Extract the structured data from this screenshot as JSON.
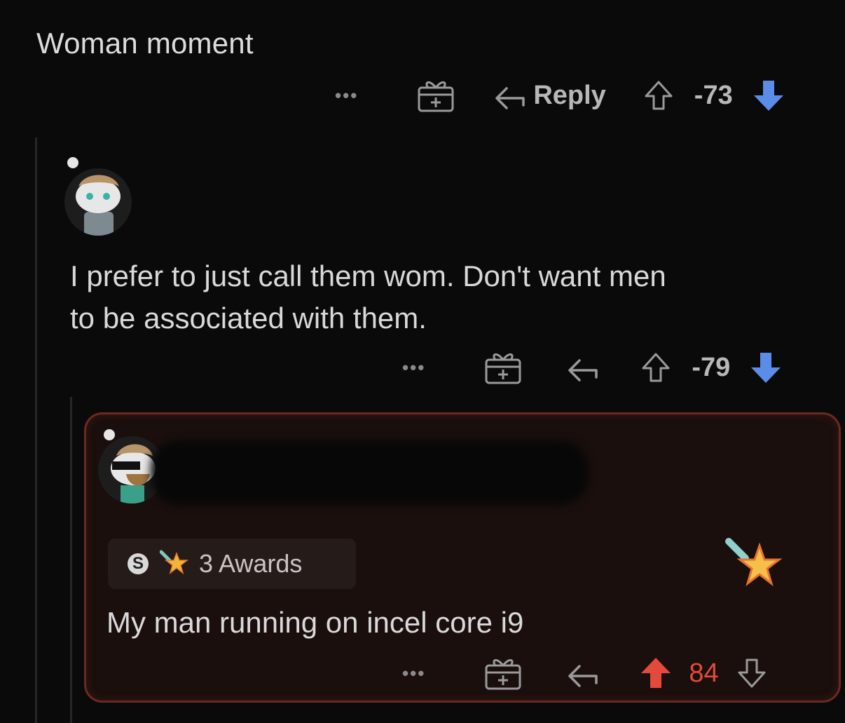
{
  "post": {
    "title": "Woman moment"
  },
  "comment1": {
    "actions": {
      "more": "•••",
      "reply_label": "Reply",
      "score": "-73"
    }
  },
  "comment2": {
    "body": [
      "I prefer to just call them wom. Don't want men",
      "to be associated with them."
    ],
    "actions": {
      "more": "•••",
      "score": "-79"
    }
  },
  "comment3": {
    "awards_label": "3 Awards",
    "silver_badge": "S",
    "body": "My man running on incel core i9",
    "actions": {
      "more": "•••",
      "score": "84"
    }
  },
  "colors": {
    "downvote_active": "#5b8de8",
    "upvote_active": "#e34a3b",
    "highlight_border": "#6b2a1f"
  },
  "icons": [
    "gift-icon",
    "reply-arrow-icon",
    "upvote-icon",
    "downvote-icon",
    "award-star-icon"
  ]
}
